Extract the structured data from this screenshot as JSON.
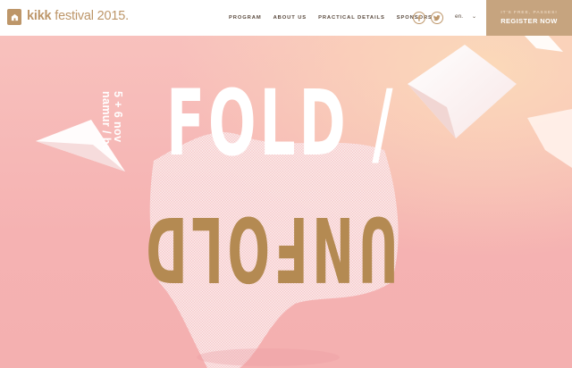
{
  "header": {
    "logo_name": "kikk",
    "logo_rest": " festival 2015.",
    "nav": [
      {
        "label": "PROGRAM"
      },
      {
        "label": "ABOUT US"
      },
      {
        "label": "PRACTICAL DETAILS"
      },
      {
        "label": "SPONSORS"
      }
    ],
    "social": [
      {
        "icon": "facebook-icon",
        "glyph": "f"
      },
      {
        "icon": "twitter-icon",
        "glyph": "t"
      }
    ],
    "language": "en.",
    "register_small": "IT'S FREE, PASSES!",
    "register_label": "REGISTER NOW"
  },
  "hero": {
    "date_line1": "5 + 6 nov",
    "date_line2": "namur / be",
    "title_top": "FOLD /",
    "title_bottom": "UNFOLD"
  },
  "colors": {
    "brand_gold": "#bd9669",
    "register_bg": "#c6a47f",
    "hero_pink": "#f7b7b8",
    "unfold_gold": "#b48a52"
  }
}
